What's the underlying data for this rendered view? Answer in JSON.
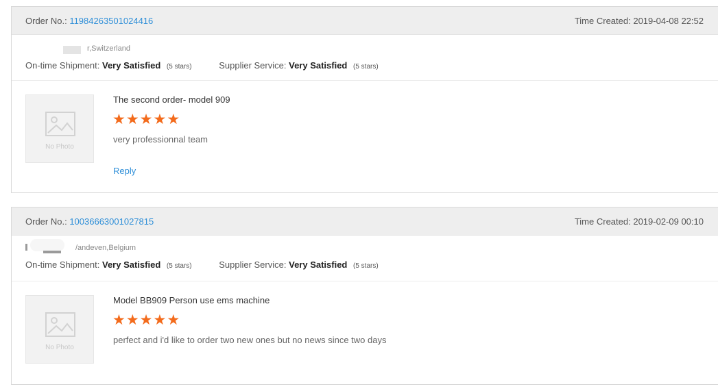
{
  "reviews": [
    {
      "order_label": "Order No.:",
      "order_number": "11984263501024416",
      "time_label": "Time Created:",
      "time_value": "2019-04-08 22:52",
      "buyer_location": "r,Switzerland",
      "ontime_label": "On-time Shipment:",
      "ontime_value": "Very Satisfied",
      "ontime_stars": "(5 stars)",
      "supplier_label": "Supplier Service:",
      "supplier_value": "Very Satisfied",
      "supplier_stars": "(5 stars)",
      "photo_text": "No Photo",
      "product_title": "The second order- model 909",
      "rating": 5,
      "comment": "very professionnal team",
      "reply_label": "Reply"
    },
    {
      "order_label": "Order No.:",
      "order_number": "10036663001027815",
      "time_label": "Time Created:",
      "time_value": "2019-02-09 00:10",
      "buyer_location": "/andeven,Belgium",
      "ontime_label": "On-time Shipment:",
      "ontime_value": "Very Satisfied",
      "ontime_stars": "(5 stars)",
      "supplier_label": "Supplier Service:",
      "supplier_value": "Very Satisfied",
      "supplier_stars": "(5 stars)",
      "photo_text": "No Photo",
      "product_title": "Model BB909 Person use ems machine",
      "rating": 5,
      "comment": "perfect and i'd like to order two new ones but no news since two days"
    }
  ],
  "colors": {
    "link": "#2f8fd8",
    "star": "#f36b1c",
    "header_bg": "#eeeeee"
  },
  "icons": {
    "star": "star-icon",
    "photo": "image-placeholder-icon"
  }
}
